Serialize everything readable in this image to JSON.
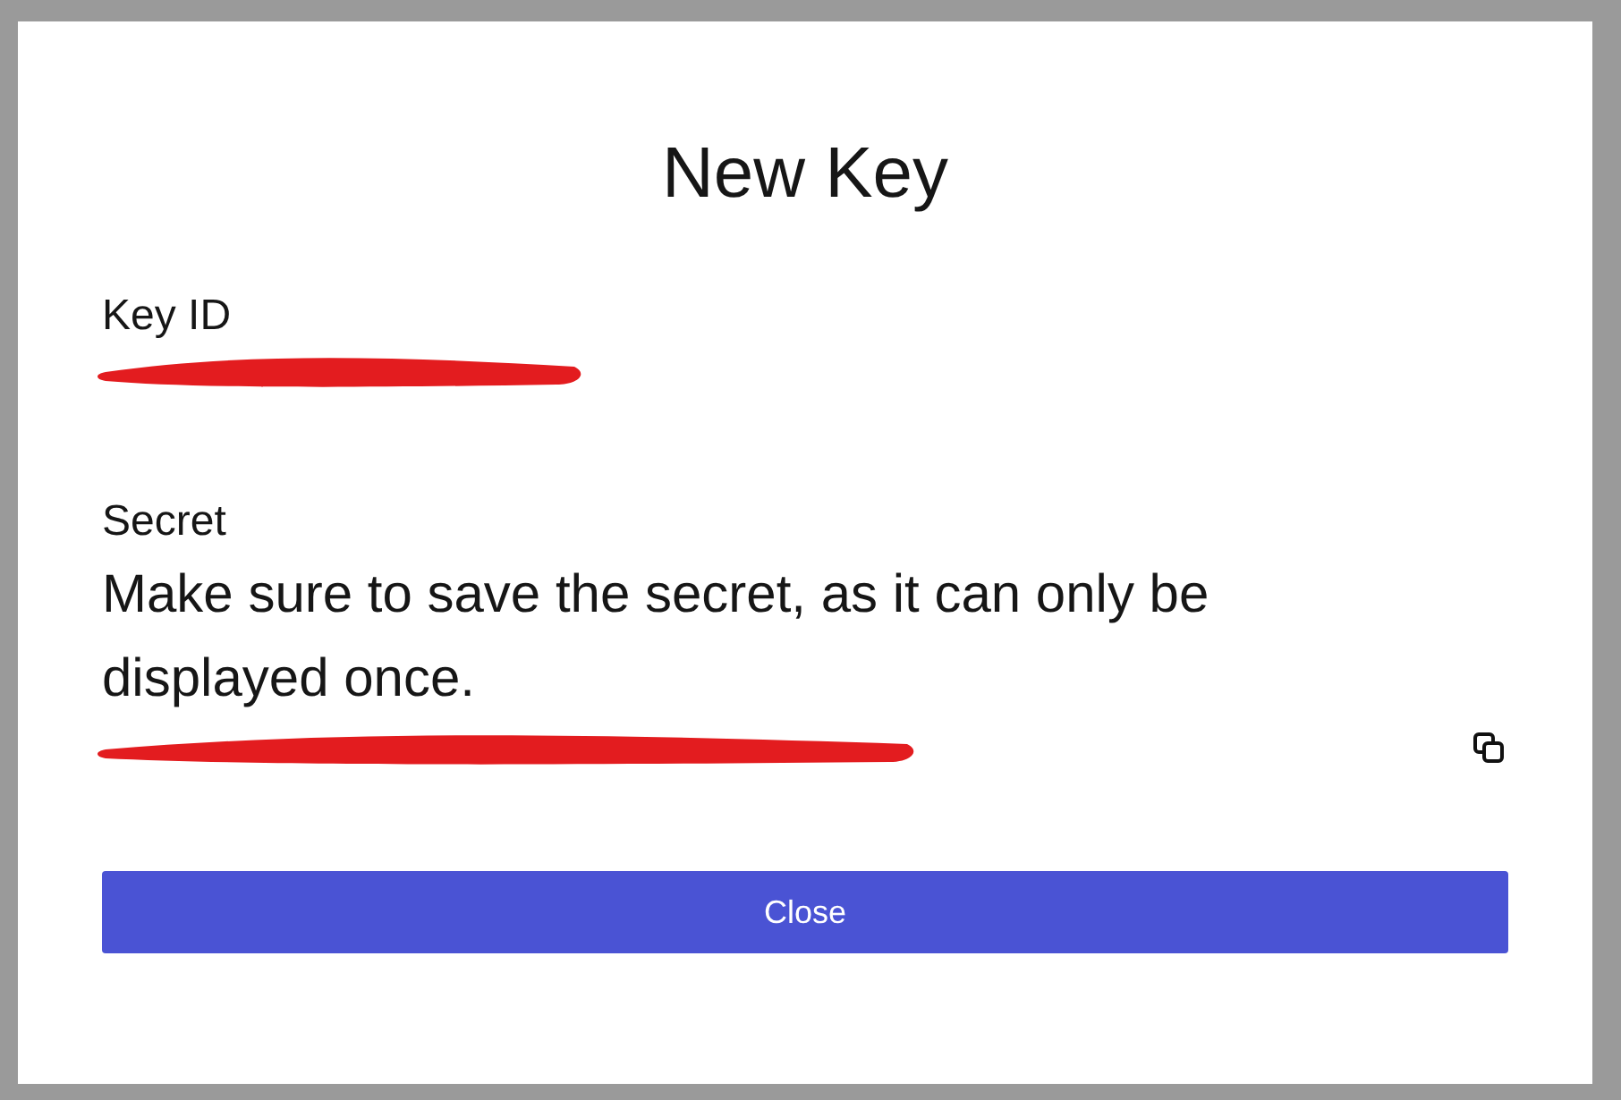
{
  "dialog": {
    "title": "New Key",
    "key_id": {
      "label": "Key ID"
    },
    "secret": {
      "label": "Secret",
      "notice": "Make sure to save the secret, as it can only be displayed once."
    },
    "buttons": [
      {
        "label": "Close",
        "kind": "primary"
      }
    ]
  }
}
